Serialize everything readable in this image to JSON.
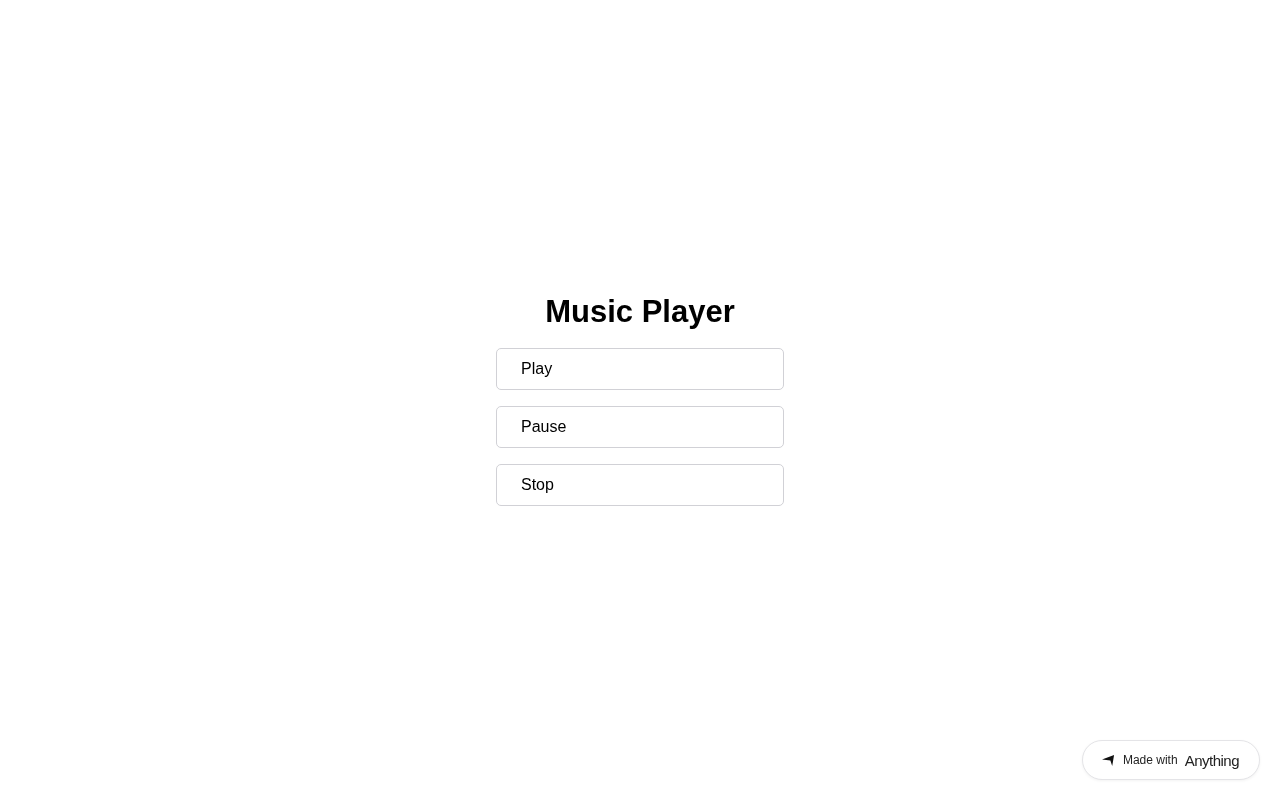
{
  "title": "Music Player",
  "buttons": [
    {
      "label": "Play"
    },
    {
      "label": "Pause"
    },
    {
      "label": "Stop"
    }
  ],
  "badge": {
    "text": "Made with",
    "brand": "Anything"
  }
}
